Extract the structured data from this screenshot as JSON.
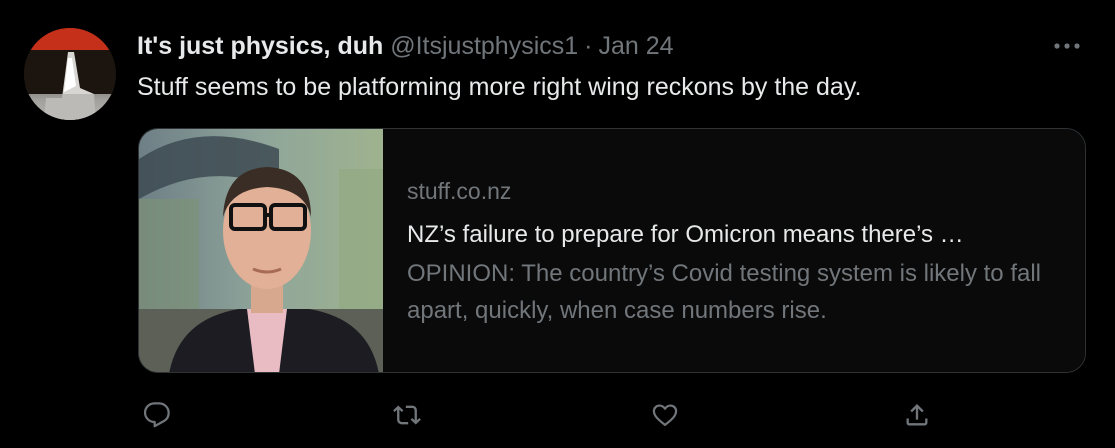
{
  "tweet": {
    "display_name": "It's just physics, duh",
    "handle": "@Itsjustphysics1",
    "separator": "·",
    "date": "Jan 24",
    "text": "Stuff seems to be platforming more right wing reckons by the day."
  },
  "card": {
    "domain": "stuff.co.nz",
    "title": "NZ’s failure to prepare for Omicron means there’s …",
    "description": "OPINION: The country’s Covid testing system is likely to fall apart, quickly, when case numbers rise."
  },
  "icons": {
    "more": "more-icon",
    "reply": "reply-icon",
    "retweet": "retweet-icon",
    "like": "heart-icon",
    "share": "share-icon"
  },
  "colors": {
    "background": "#000000",
    "primary_text": "#e7e9ea",
    "secondary_text": "#71767b",
    "border": "#2f3336"
  }
}
